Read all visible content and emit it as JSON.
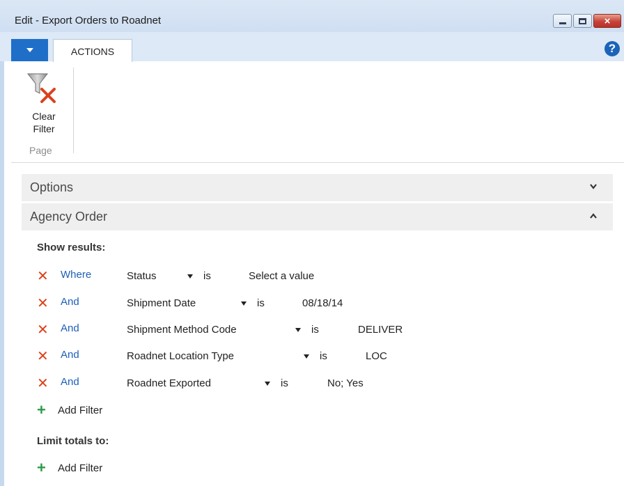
{
  "window": {
    "title": "Edit - Export Orders to Roadnet",
    "close_glyph": "×"
  },
  "ribbon": {
    "tab_actions": "ACTIONS",
    "help_glyph": "?",
    "clear_filter_line1": "Clear",
    "clear_filter_line2": "Filter",
    "group_label": "Page"
  },
  "sections": {
    "options": "Options",
    "agency_order": "Agency Order"
  },
  "filters": {
    "show_results_label": "Show results:",
    "rows": [
      {
        "cond": "Where",
        "field": "Status",
        "op": "is",
        "value": "Select a value"
      },
      {
        "cond": "And",
        "field": "Shipment Date",
        "op": "is",
        "value": "08/18/14"
      },
      {
        "cond": "And",
        "field": "Shipment Method Code",
        "op": "is",
        "value": "DELIVER"
      },
      {
        "cond": "And",
        "field": "Roadnet Location Type",
        "op": "is",
        "value": "LOC"
      },
      {
        "cond": "And",
        "field": "Roadnet Exported",
        "op": "is",
        "value": "No; Yes"
      }
    ],
    "add_filter_label": "Add Filter",
    "limit_totals_label": "Limit totals to:",
    "add_filter_label_2": "Add Filter"
  },
  "colors": {
    "accent_blue": "#1f6fc9",
    "link_blue": "#1d5fb8",
    "remove_red": "#d9421c",
    "add_green": "#2e9a48"
  }
}
